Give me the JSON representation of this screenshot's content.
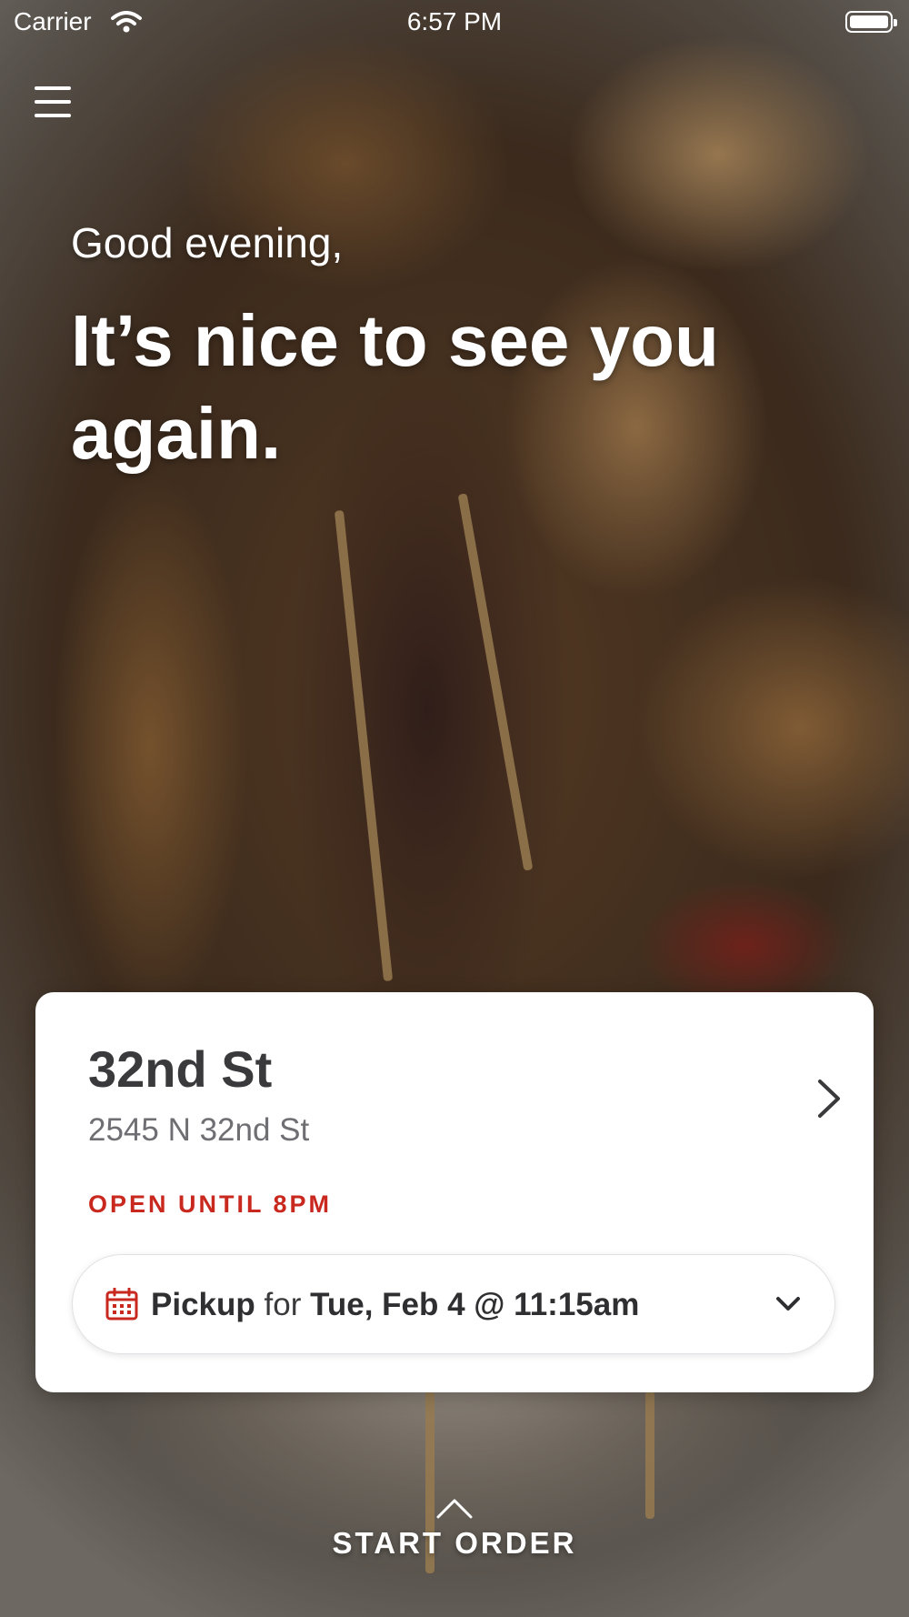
{
  "status_bar": {
    "carrier": "Carrier",
    "time": "6:57 PM"
  },
  "greeting": {
    "salutation": "Good evening,",
    "headline": "It’s nice to see you again."
  },
  "location": {
    "name": "32nd St",
    "address": "2545 N 32nd St",
    "hours": "OPEN UNTIL 8PM"
  },
  "order_time": {
    "method": "Pickup",
    "connector": "for",
    "datetime": "Tue, Feb 4 @ 11:15am"
  },
  "cta": {
    "label": "START ORDER"
  },
  "icons": {
    "menu": "hamburger-menu-icon",
    "wifi": "wifi-icon",
    "battery": "battery-icon",
    "location_chevron": "chevron-right-icon",
    "calendar": "calendar-icon",
    "dropdown": "chevron-down-icon",
    "start_order": "chevron-up-icon"
  },
  "colors": {
    "accent_red": "#c8281e",
    "card_text": "#3a3a3c",
    "secondary_text": "#6e6e73"
  }
}
